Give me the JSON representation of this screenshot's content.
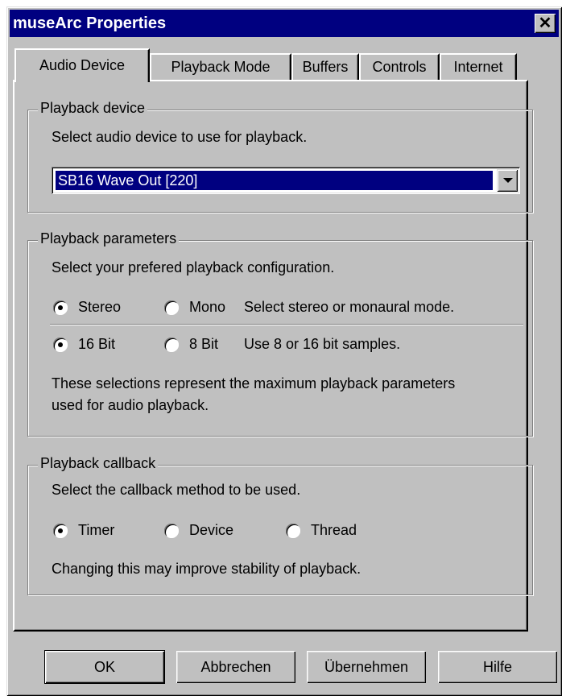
{
  "window": {
    "title": "museArc Properties",
    "close_glyph": "✕"
  },
  "tabs": [
    "Audio Device",
    "Playback Mode",
    "Buffers",
    "Controls",
    "Internet"
  ],
  "playback_device": {
    "title": "Playback device",
    "description": "Select audio device to use for playback.",
    "selected": "SB16 Wave Out [220]"
  },
  "playback_parameters": {
    "title": "Playback parameters",
    "description": "Select your prefered playback configuration.",
    "mode_options": [
      "Stereo",
      "Mono"
    ],
    "mode_selected": "Stereo",
    "mode_hint": "Select stereo or monaural mode.",
    "bits_options": [
      "16 Bit",
      "8 Bit"
    ],
    "bits_selected": "16 Bit",
    "bits_hint": "Use 8 or 16 bit samples.",
    "note_line1": "These selections represent the maximum playback parameters",
    "note_line2": "used for audio playback."
  },
  "playback_callback": {
    "title": "Playback callback",
    "description": "Select the callback method to be used.",
    "options": [
      "Timer",
      "Device",
      "Thread"
    ],
    "selected": "Timer",
    "note": "Changing this may improve stability of playback."
  },
  "buttons": {
    "ok": "OK",
    "cancel": "Abbrechen",
    "apply": "Übernehmen",
    "help": "Hilfe"
  }
}
